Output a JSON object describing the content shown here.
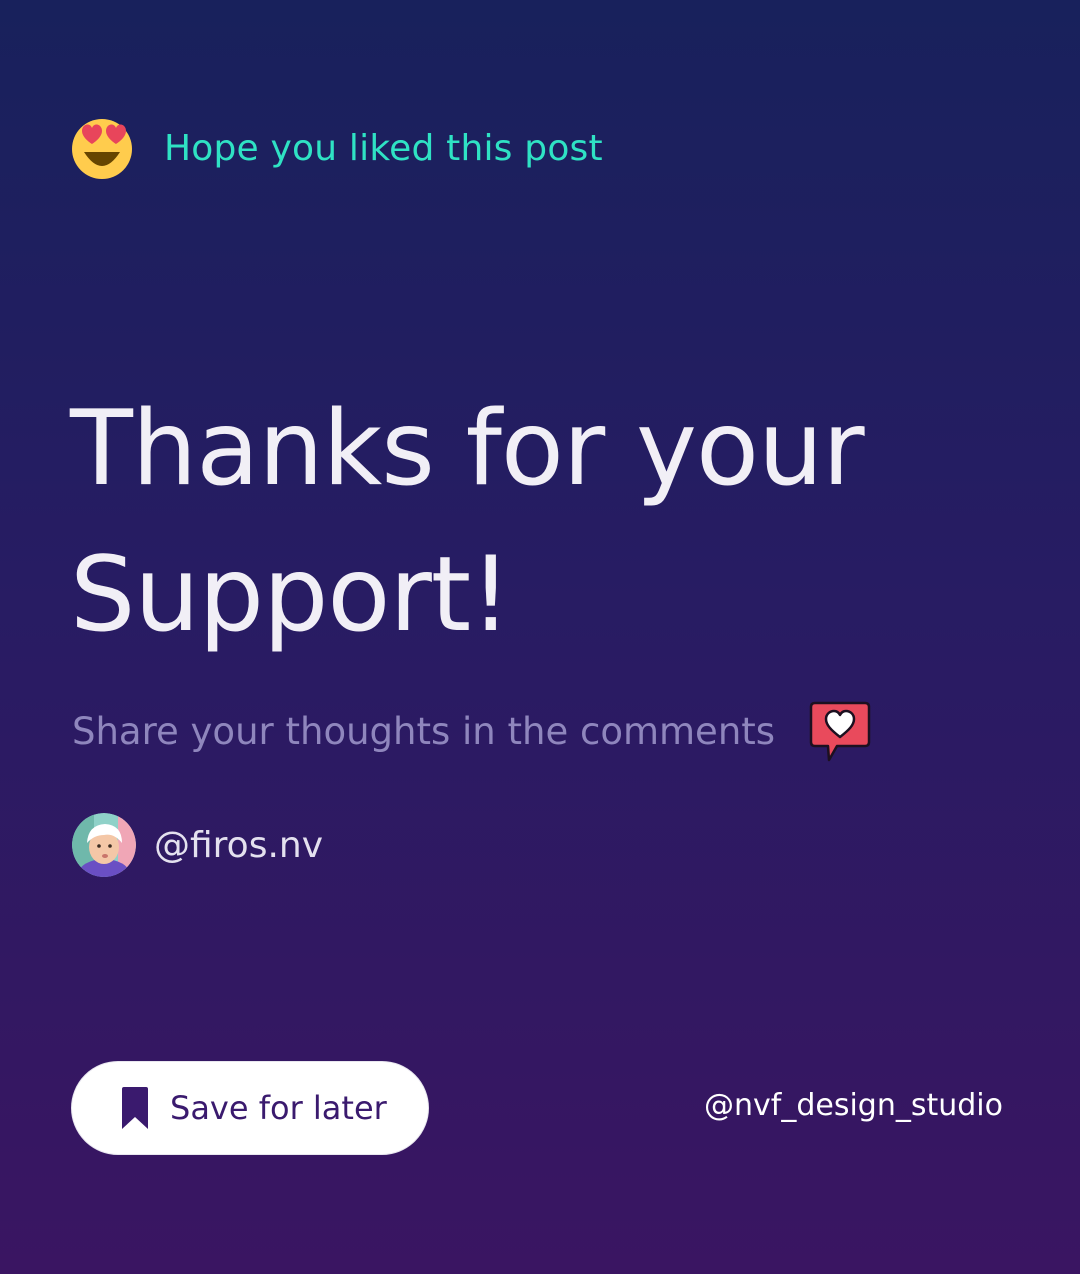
{
  "greeting": {
    "text": "Hope you liked this post",
    "icon": "heart-eyes-emoji-icon"
  },
  "headline": {
    "line1": "Thanks for your",
    "line2": "Support!"
  },
  "subline": {
    "text": "Share your thoughts in the comments",
    "icon": "heart-speech-bubble-icon"
  },
  "author": {
    "handle": "@firos.nv",
    "avatar": "avatar-photo"
  },
  "save_button": {
    "label": "Save for later",
    "icon": "bookmark-icon"
  },
  "footer": {
    "studio_handle": "@nvf_design_studio"
  },
  "colors": {
    "background_top": "#18215c",
    "background_bottom": "#3a1562",
    "accent_teal": "#2fe2c4",
    "headline": "#f1eff6",
    "muted": "#8f86bd",
    "button_text": "#3a1a6e"
  }
}
